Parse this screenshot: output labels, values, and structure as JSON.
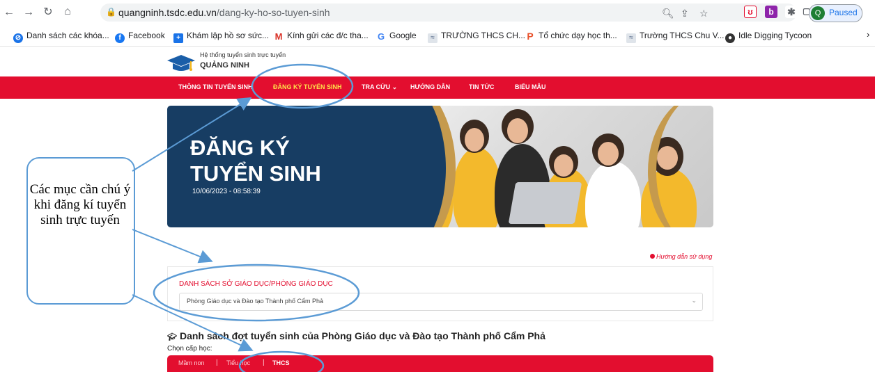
{
  "browser": {
    "url_host": "quangninh.tsdc.edu.vn",
    "url_path": "/dang-ky-ho-so-tuyen-sinh",
    "profile_initial": "Q",
    "profile_status": "Paused",
    "bookmarks": [
      {
        "label": "Danh sách các khóa...",
        "icon": "bookmark-globe-icon",
        "color": "#1a73e8"
      },
      {
        "label": "Facebook",
        "icon": "facebook-icon",
        "color": "#1877f2"
      },
      {
        "label": "Khám lập hồ sơ sức...",
        "icon": "plus-square-icon",
        "color": "#1a73e8"
      },
      {
        "label": "Kính gửi các đ/c tha...",
        "icon": "gmail-icon",
        "color": "#d93025"
      },
      {
        "label": "Google",
        "icon": "google-icon",
        "color": "#4285f4"
      },
      {
        "label": "TRƯỜNG THCS CH...",
        "icon": "school-icon",
        "color": "#7a8aa3"
      },
      {
        "label": "Tổ chức dạy học th...",
        "icon": "p-icon",
        "color": "#e8512b"
      },
      {
        "label": "Trường THCS Chu V...",
        "icon": "school-icon",
        "color": "#7a8aa3"
      },
      {
        "label": "Idle Digging Tycoon",
        "icon": "game-icon",
        "color": "#333333"
      }
    ]
  },
  "site": {
    "subtitle": "Hệ thống tuyển sinh trực tuyến",
    "name": "QUẢNG NINH",
    "nav": [
      {
        "label": "THÔNG TIN TUYỂN SINH"
      },
      {
        "label": "ĐĂNG KÝ TUYỂN SINH"
      },
      {
        "label": "TRA CỨU ⌄"
      },
      {
        "label": "HƯỚNG DẪN"
      },
      {
        "label": "TIN TỨC"
      },
      {
        "label": "BIỂU MẪU"
      }
    ]
  },
  "banner": {
    "title_line1": "ĐĂNG KÝ",
    "title_line2": "TUYỂN SINH",
    "datetime": "10/06/2023 - 08:58:39"
  },
  "callout": {
    "text": "Các mục cần chú ý khi đăng kí tuyển sinh trực tuyến"
  },
  "help_link": "Hướng dẫn sử dụng",
  "department": {
    "title": "DANH SÁCH SỞ GIÁO DỤC/PHÒNG GIÁO DỤC",
    "selected": "Phòng Giáo dục và Đào tạo Thành phố Cẩm Phả"
  },
  "rounds": {
    "title": "Danh sách đợt tuyển sinh của Phòng Giáo dục và Đào tạo Thành phố Cẩm Phả",
    "level_label": "Chọn cấp học:",
    "levels": [
      "Mầm non",
      "Tiểu học",
      "THCS"
    ]
  },
  "colors": {
    "brand_red": "#e30e2f",
    "banner_blue": "#173d63",
    "gold": "#c59a4d",
    "annotation_blue": "#5b9bd5"
  }
}
